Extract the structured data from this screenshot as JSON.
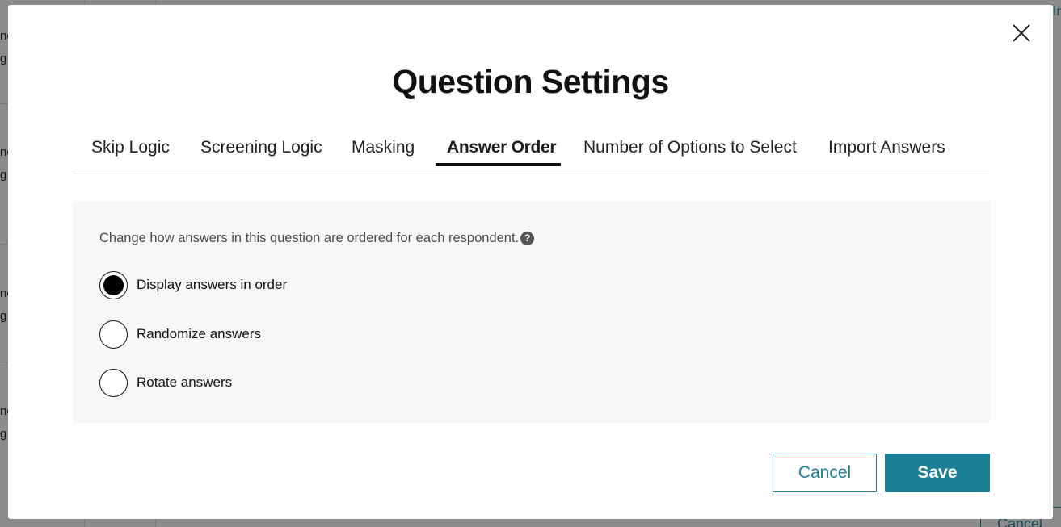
{
  "modal": {
    "title": "Question Settings",
    "close_icon": "close-icon"
  },
  "tabs": [
    {
      "label": "Skip Logic",
      "active": false
    },
    {
      "label": "Screening Logic",
      "active": false
    },
    {
      "label": "Masking",
      "active": false
    },
    {
      "label": "Answer Order",
      "active": true
    },
    {
      "label": "Number of Options to Select",
      "active": false
    },
    {
      "label": "Import Answers",
      "active": false
    }
  ],
  "answer_order": {
    "description": "Change how answers in this question are ordered for each respondent.",
    "help_icon": "question-circle-icon",
    "options": [
      {
        "label": "Display answers in order",
        "selected": true
      },
      {
        "label": "Randomize answers",
        "selected": false
      },
      {
        "label": "Rotate answers",
        "selected": false
      }
    ]
  },
  "footer": {
    "cancel_label": "Cancel",
    "save_label": "Save"
  },
  "background": {
    "fragments": [
      "nc",
      "g",
      "nc",
      "g",
      "nc",
      "g",
      "nc",
      "g"
    ],
    "cancel_label": "Cancel",
    "top_right_fragment": "In"
  },
  "colors": {
    "accent": "#1a7f96",
    "panel_bg": "#f7f7f7",
    "overlay": "rgba(0,0,0,0.45)"
  }
}
